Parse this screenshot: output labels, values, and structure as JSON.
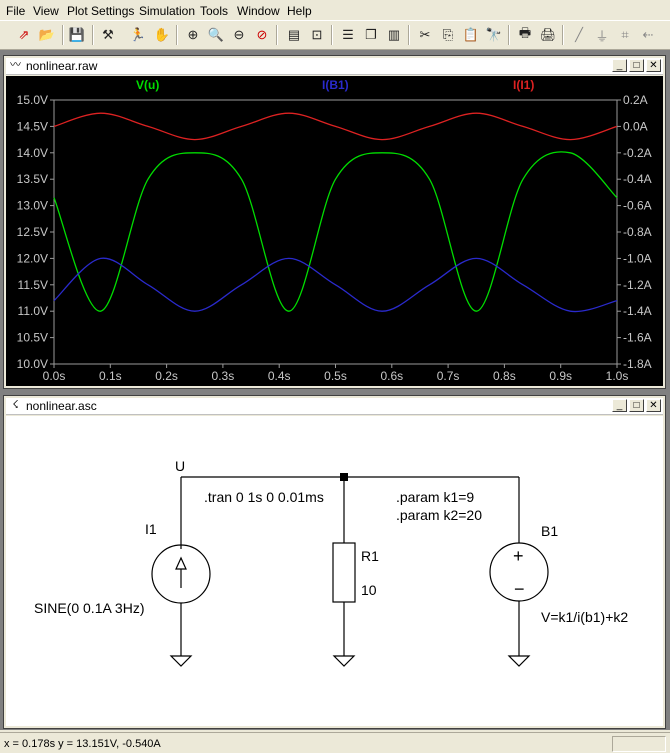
{
  "menu": [
    "File",
    "View",
    "Plot Settings",
    "Simulation",
    "Tools",
    "Window",
    "Help"
  ],
  "plot_window": {
    "title": "nonlinear.raw",
    "traces": [
      {
        "label": "V(u)",
        "color": "#00dd00"
      },
      {
        "label": "I(B1)",
        "color": "#2a2acc"
      },
      {
        "label": "I(I1)",
        "color": "#dd2222"
      }
    ],
    "left_ticks": [
      "15.0V",
      "14.5V",
      "14.0V",
      "13.5V",
      "13.0V",
      "12.5V",
      "12.0V",
      "11.5V",
      "11.0V",
      "10.5V",
      "10.0V"
    ],
    "right_ticks": [
      "0.2A",
      "0.0A",
      "-0.2A",
      "-0.4A",
      "-0.6A",
      "-0.8A",
      "-1.0A",
      "-1.2A",
      "-1.4A",
      "-1.6A",
      "-1.8A"
    ],
    "x_ticks": [
      "0.0s",
      "0.1s",
      "0.2s",
      "0.3s",
      "0.4s",
      "0.5s",
      "0.6s",
      "0.7s",
      "0.8s",
      "0.9s",
      "1.0s"
    ]
  },
  "chart_data": {
    "type": "line",
    "x": [
      0,
      0.083,
      0.167,
      0.25,
      0.333,
      0.417,
      0.5,
      0.583,
      0.667,
      0.75,
      0.833,
      0.917,
      1.0
    ],
    "series": [
      {
        "name": "V(u)",
        "axis": "left",
        "color": "#00dd00",
        "values": [
          13.15,
          11.0,
          13.5,
          14.0,
          13.5,
          11.0,
          13.5,
          14.0,
          13.5,
          11.0,
          13.5,
          14.0,
          13.15
        ]
      },
      {
        "name": "I(B1)",
        "axis": "right",
        "color": "#2a2acc",
        "values": [
          -1.32,
          -1.0,
          -1.2,
          -1.4,
          -1.2,
          -1.0,
          -1.2,
          -1.4,
          -1.2,
          -1.0,
          -1.2,
          -1.4,
          -1.32
        ]
      },
      {
        "name": "I(I1)",
        "axis": "right",
        "color": "#dd2222",
        "values": [
          0.0,
          0.1,
          0.0,
          -0.1,
          0.0,
          0.1,
          0.0,
          -0.1,
          0.0,
          0.1,
          0.0,
          -0.1,
          0.0
        ]
      }
    ],
    "xlim": [
      0,
      1.0
    ],
    "ylim_left": [
      10.0,
      15.0
    ],
    "ylim_right": [
      -1.8,
      0.2
    ],
    "grid": false
  },
  "schematic_window": {
    "title": "nonlinear.asc",
    "node_label": "U",
    "directive_tran": ".tran 0 1s 0 0.01ms",
    "param1": ".param k1=9",
    "param2": ".param k2=20",
    "i1_name": "I1",
    "i1_value": "SINE(0 0.1A 3Hz)",
    "r1_name": "R1",
    "r1_value": "10",
    "b1_name": "B1",
    "b1_value": "V=k1/i(b1)+k2"
  },
  "status": {
    "text": "x = 0.178s    y = 13.151V, -0.540A"
  }
}
